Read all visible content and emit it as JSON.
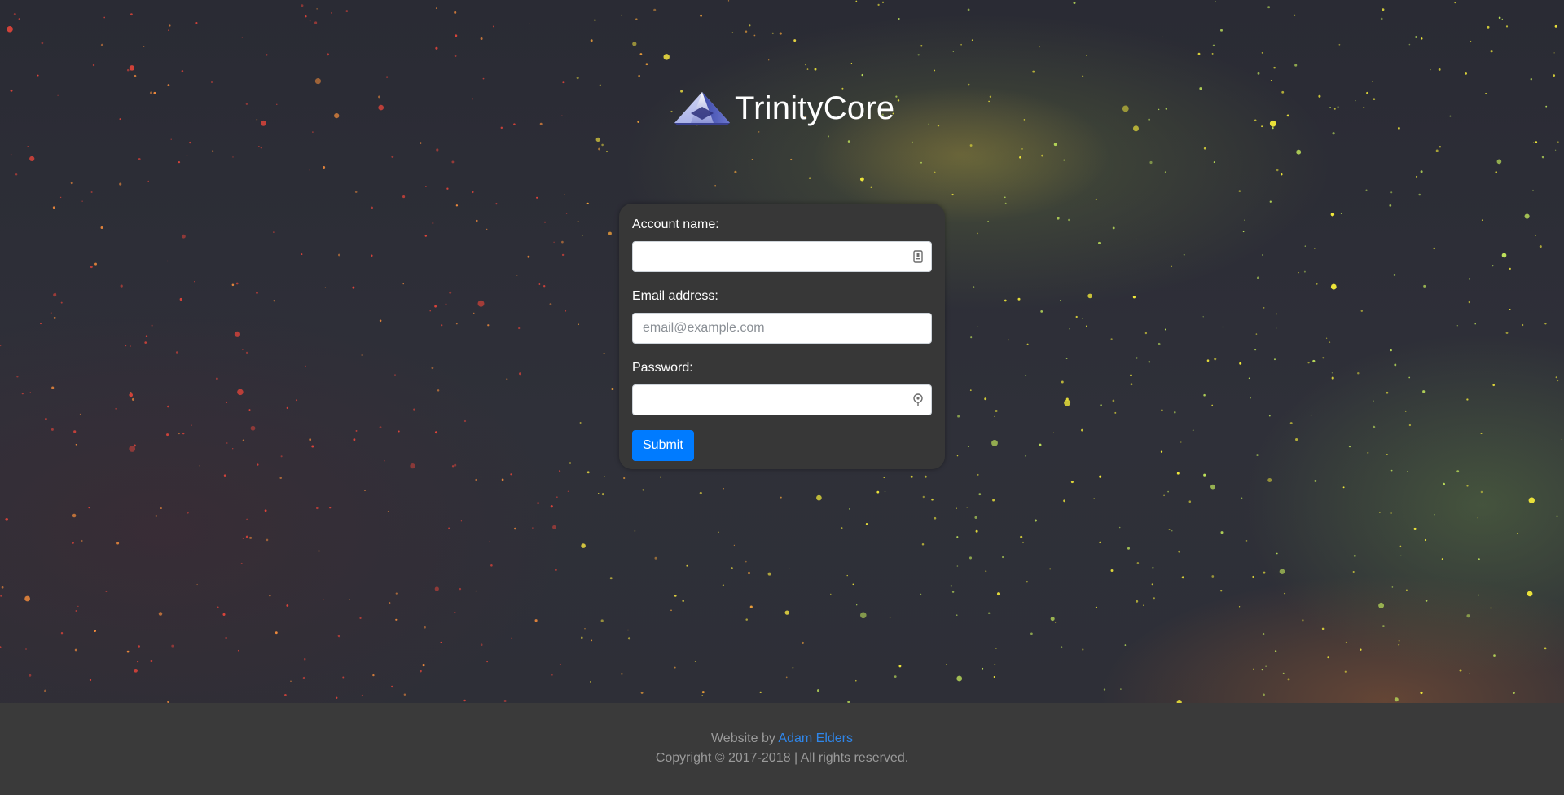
{
  "brand": {
    "name": "TrinityCore"
  },
  "form": {
    "account_label": "Account name:",
    "account_value": "",
    "email_label": "Email address:",
    "email_placeholder": "email@example.com",
    "email_value": "",
    "password_label": "Password:",
    "password_value": "",
    "submit_label": "Submit"
  },
  "footer": {
    "credit_prefix": "Website by",
    "credit_link": "Adam Elders",
    "copyright": "Copyright © 2017-2018 | All rights reserved."
  },
  "colors": {
    "card": "#373737",
    "submit": "#007bff",
    "footer_bg": "#3a3a3a",
    "footer_text": "#9a9a9a",
    "link": "#2f86ea"
  },
  "icons": {
    "account_input": "id-card-icon",
    "password_input": "key-icon"
  }
}
